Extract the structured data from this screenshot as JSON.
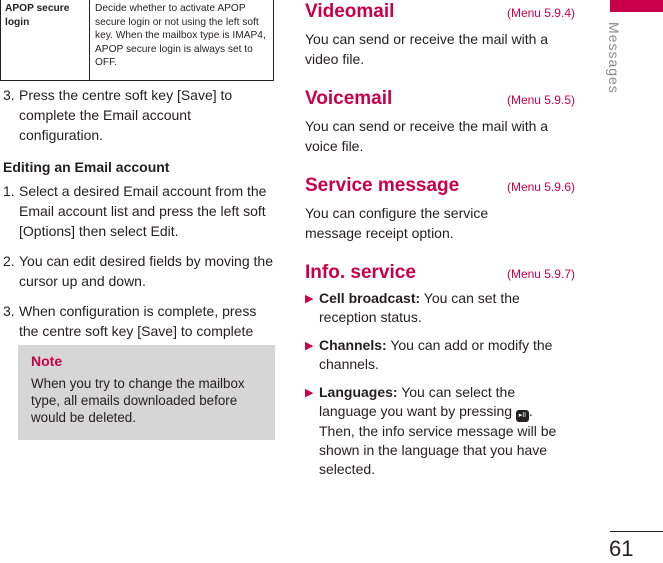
{
  "table": {
    "label": "APOP secure login",
    "description": "Decide whether to activate APOP secure login or not using the left soft key. When the mailbox type is IMAP4, APOP secure login is always set to OFF."
  },
  "left": {
    "step3_num": "3.",
    "step3_text": "Press the centre soft key [Save] to complete the Email account configuration.",
    "heading": "Editing an Email account",
    "steps": [
      {
        "num": "1.",
        "text": "Select a desired Email account from the Email account list and press the left soft [Options] then select Edit."
      },
      {
        "num": "2.",
        "text": "You can edit desired fields by moving the cursor up and down."
      },
      {
        "num": "3.",
        "text": "When configuration is complete, press the centre soft key [Save] to complete the Email account configuration."
      }
    ],
    "note": {
      "title": "Note",
      "body": "When you try to change the mailbox type, all emails downloaded before would be deleted."
    }
  },
  "right": {
    "sections": [
      {
        "title": "Videomail",
        "menu": "(Menu 5.9.4)",
        "body": "You can send or receive the mail with a video file."
      },
      {
        "title": "Voicemail",
        "menu": "(Menu 5.9.5)",
        "body": "You can send or receive the mail with a voice file."
      },
      {
        "title": "Service message",
        "menu": "(Menu 5.9.6)",
        "body": "You can configure the service message receipt option."
      },
      {
        "title": "Info. service",
        "menu": "(Menu 5.9.7)"
      }
    ],
    "bullets": [
      {
        "term": "Cell broadcast:",
        "text": " You can set the reception status."
      },
      {
        "term": "Channels:",
        "text": " You can add or modify the channels."
      },
      {
        "term": "Languages:",
        "text_before": " You can select the language you want by pressing ",
        "text_after": ". Then, the info service message will be shown in the language that you have selected."
      }
    ],
    "key_icon_glyph": "▸II"
  },
  "side": {
    "label": "Messages",
    "page_number": "61",
    "accent_color": "#c8004a"
  }
}
